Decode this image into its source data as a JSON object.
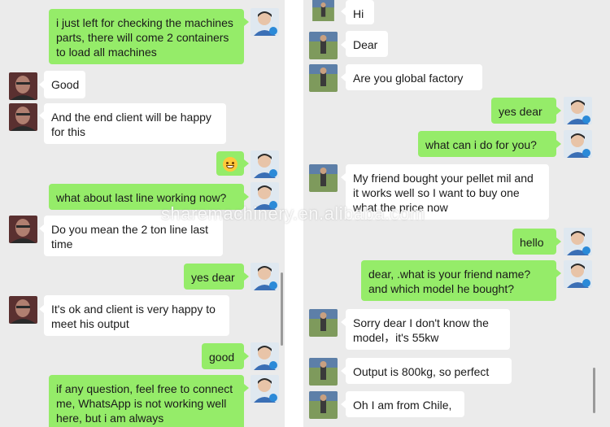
{
  "left_chat": {
    "messages": [
      {
        "dir": "out",
        "text": "i just left for checking the machines parts, there will come 2 containers to load all machines"
      },
      {
        "dir": "in",
        "text": "Good"
      },
      {
        "dir": "in",
        "text": "And the end client will be happy for this"
      },
      {
        "dir": "out",
        "text": "",
        "emoji": "grinning-face"
      },
      {
        "dir": "out",
        "text": "what about last line working now?"
      },
      {
        "dir": "in",
        "text": "Do you mean the 2 ton line last time"
      },
      {
        "dir": "out",
        "text": "yes dear"
      },
      {
        "dir": "in",
        "text": "It's ok and client is very happy to meet his output"
      },
      {
        "dir": "out",
        "text": "good"
      },
      {
        "dir": "out",
        "text": "if any question, feel free to connect me, WhatsApp is not working well here, but i am always"
      }
    ]
  },
  "right_chat": {
    "messages": [
      {
        "dir": "in",
        "text": "Hi"
      },
      {
        "dir": "in",
        "text": "Dear"
      },
      {
        "dir": "in",
        "text": "Are you global factory"
      },
      {
        "dir": "out",
        "text": "yes dear"
      },
      {
        "dir": "out",
        "text": "what can i do for you?"
      },
      {
        "dir": "in",
        "text": "My friend bought your pellet mil and it works well so I want to buy one what the price now"
      },
      {
        "dir": "out",
        "text": "hello"
      },
      {
        "dir": "out",
        "text": "dear, .what is your friend name? and which model he bought?"
      },
      {
        "dir": "in",
        "text": "Sorry dear I don't know the model，it's 55kw"
      },
      {
        "dir": "in",
        "text": "Output is 800kg, so perfect"
      },
      {
        "dir": "in",
        "text": "Oh I am from Chile,"
      }
    ]
  },
  "watermark": "sharemachinery.en.alibaba.com",
  "colors": {
    "out_bubble": "#95ec69",
    "in_bubble": "#ffffff",
    "background": "#ebebeb"
  }
}
